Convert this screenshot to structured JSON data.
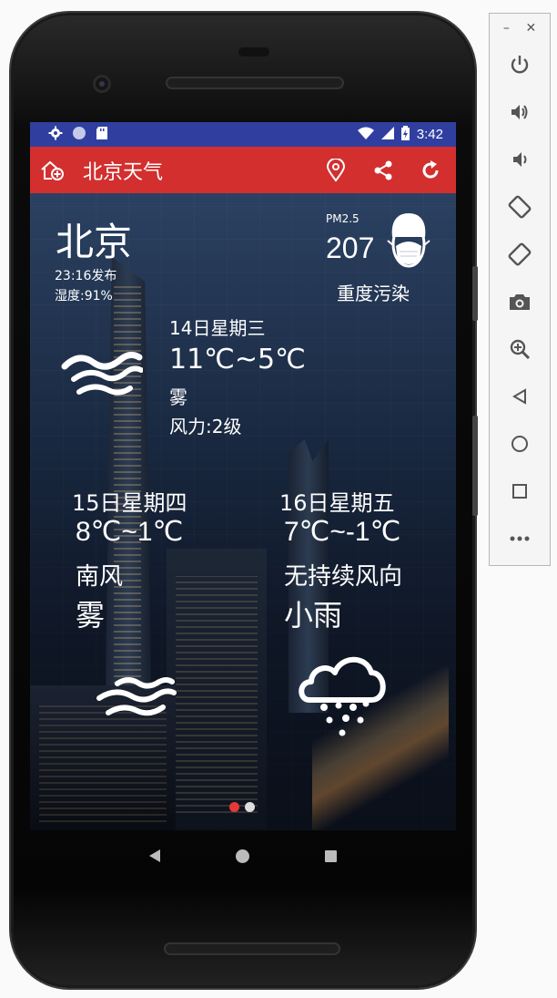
{
  "status_bar": {
    "time": "3:42"
  },
  "app_bar": {
    "title": "北京天气"
  },
  "city": "北京",
  "published": "23:16发布",
  "humidity": "湿度:91%",
  "air": {
    "label": "PM2.5",
    "value": "207",
    "quality": "重度污染"
  },
  "today": {
    "date": "14日星期三",
    "temp": "11℃~5℃",
    "condition": "雾",
    "wind": "风力:2级",
    "icon": "fog-icon"
  },
  "forecast": [
    {
      "date": "15日星期四",
      "temp": "8℃~1℃",
      "wind": "南风",
      "condition": "雾",
      "icon": "fog-icon"
    },
    {
      "date": "16日星期五",
      "temp": "7℃~-1℃",
      "wind": "无持续风向",
      "condition": "小雨",
      "icon": "light-rain-icon"
    }
  ],
  "pager": {
    "pages": 2,
    "active": 1,
    "active_color": "#e53935",
    "inactive_color": "#dddddd"
  },
  "colors": {
    "status_bar": "#303f9f",
    "app_bar": "#d32f2f"
  },
  "toolbar": {
    "items": [
      "power-icon",
      "volume-up-icon",
      "volume-down-icon",
      "rotate-left-icon",
      "rotate-right-icon",
      "camera-icon",
      "zoom-icon",
      "back-icon",
      "home-icon",
      "overview-icon",
      "more-icon"
    ]
  }
}
